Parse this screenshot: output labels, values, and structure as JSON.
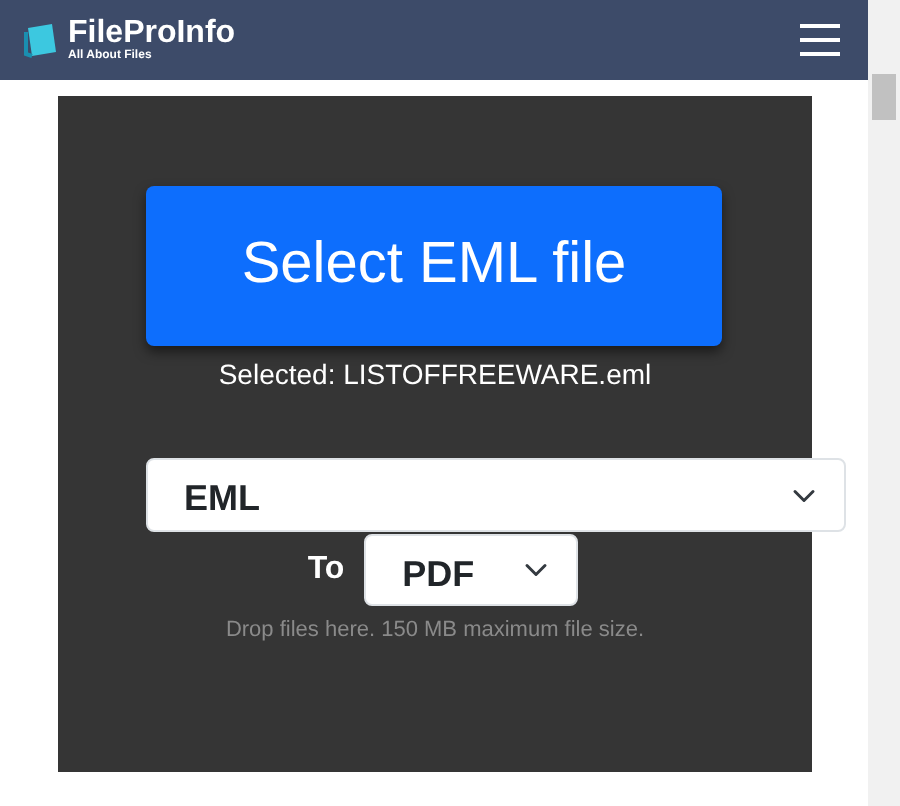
{
  "header": {
    "logo_title": "FileProInfo",
    "logo_tagline": "All About Files"
  },
  "upload": {
    "button": "Select EML file",
    "selected_file": "Selected: LISTOFFREEWARE.eml",
    "from_format": "EML",
    "to_label": "To",
    "to_format": "PDF",
    "hint": "Drop files here. 150 MB maximum file size."
  }
}
